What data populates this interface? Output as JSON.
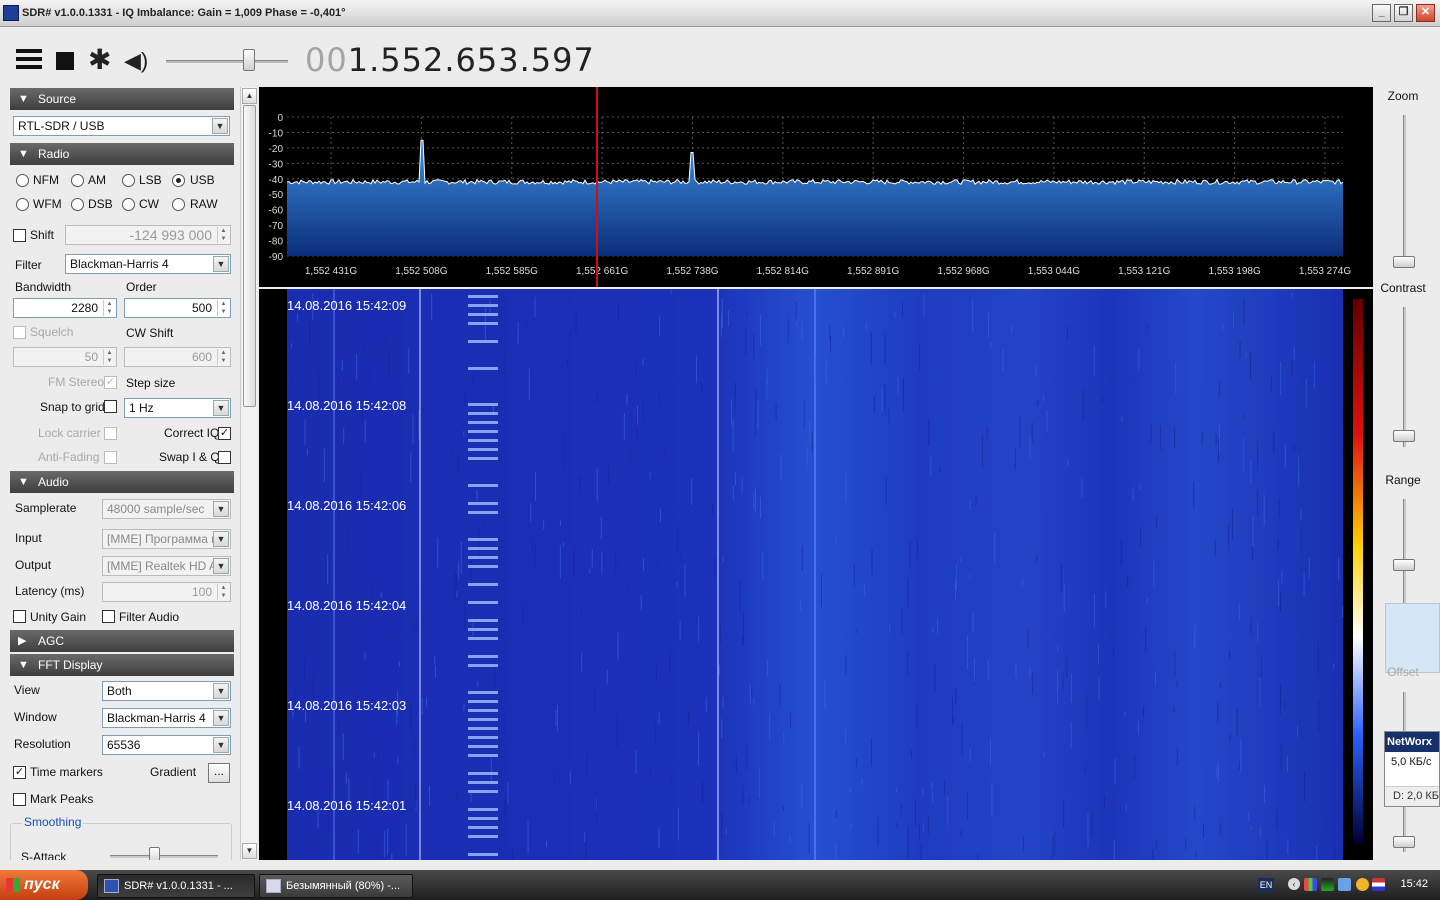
{
  "window": {
    "title": "SDR# v1.0.0.1331 - IQ Imbalance: Gain = 1,009 Phase = -0,401°",
    "min_label": "_",
    "max_label": "❐",
    "close_label": "✕"
  },
  "toolbar": {
    "frequency_dim": "00",
    "frequency_main": "1.552.653.597",
    "gear_glyph": "✱",
    "speaker_glyph": "◀)"
  },
  "source": {
    "header": "Source",
    "device": "RTL-SDR / USB"
  },
  "radio": {
    "header": "Radio",
    "modes": [
      "NFM",
      "AM",
      "LSB",
      "USB",
      "WFM",
      "DSB",
      "CW",
      "RAW"
    ],
    "selected_mode": "USB",
    "shift_label": "Shift",
    "shift_value": "-124 993 000",
    "filter_label": "Filter",
    "filter_value": "Blackman-Harris 4",
    "bandwidth_label": "Bandwidth",
    "bandwidth_value": "2280",
    "order_label": "Order",
    "order_value": "500",
    "squelch_label": "Squelch",
    "squelch_value": "50",
    "cwshift_label": "CW Shift",
    "cwshift_value": "600",
    "fmstereo_label": "FM Stereo",
    "stepsize_label": "Step size",
    "snap_label": "Snap to grid",
    "step_value": "1 Hz",
    "lockcarrier_label": "Lock carrier",
    "correctiq_label": "Correct IQ",
    "antifading_label": "Anti-Fading",
    "swapiq_label": "Swap I & Q"
  },
  "audio": {
    "header": "Audio",
    "samplerate_label": "Samplerate",
    "samplerate_value": "48000 sample/sec",
    "input_label": "Input",
    "input_value": "[MME] Программа пе",
    "output_label": "Output",
    "output_value": "[MME] Realtek HD Au",
    "latency_label": "Latency (ms)",
    "latency_value": "100",
    "unitygain_label": "Unity Gain",
    "filteraudio_label": "Filter Audio"
  },
  "agc": {
    "header": "AGC"
  },
  "fft": {
    "header": "FFT Display",
    "view_label": "View",
    "view_value": "Both",
    "window_label": "Window",
    "window_value": "Blackman-Harris 4",
    "resolution_label": "Resolution",
    "resolution_value": "65536",
    "timemarkers_label": "Time markers",
    "gradient_label": "Gradient",
    "gradient_btn": "...",
    "markpeaks_label": "Mark Peaks",
    "smoothing_label": "Smoothing",
    "sattack_label": "S-Attack"
  },
  "chart_data": {
    "type": "line",
    "y_ticks": [
      "0",
      "-10",
      "-20",
      "-30",
      "-40",
      "-50",
      "-60",
      "-70",
      "-80",
      "-90"
    ],
    "ylim": [
      -90,
      0
    ],
    "x_ticks": [
      "1,552 431G",
      "1,552 508G",
      "1,552 585G",
      "1,552 661G",
      "1,552 738G",
      "1,552 814G",
      "1,552 891G",
      "1,552 968G",
      "1,553 044G",
      "1,553 121G",
      "1,553 198G",
      "1,553 274G"
    ],
    "noise_floor_db": -42,
    "peaks": [
      {
        "freq": "1,552 508G",
        "db": -15
      },
      {
        "freq": "1,552 738G",
        "db": -23
      }
    ]
  },
  "waterfall": {
    "timestamps": [
      "14.08.2016 15:42:09",
      "14.08.2016 15:42:08",
      "14.08.2016 15:42:06",
      "14.08.2016 15:42:04",
      "14.08.2016 15:42:03",
      "14.08.2016 15:42:01"
    ]
  },
  "right": {
    "zoom_label": "Zoom",
    "contrast_label": "Contrast",
    "range_label": "Range",
    "offset_label": "Offset"
  },
  "networx": {
    "title": "NetWorx",
    "rate": "5,0 КБ/с",
    "download": "D: 2,0 КБ"
  },
  "taskbar": {
    "start_label": "пуск",
    "tasks": [
      "SDR# v1.0.0.1331 - ...",
      "Безымянный (80%) -..."
    ],
    "lang": "EN",
    "time": "15:42"
  },
  "colors": {
    "spectrum_fill_top": "#3d8fe0",
    "spectrum_fill_bottom": "#0b2d7a",
    "waterfall_bg": "#1a2fb8",
    "tuning_line": "#d01010"
  }
}
